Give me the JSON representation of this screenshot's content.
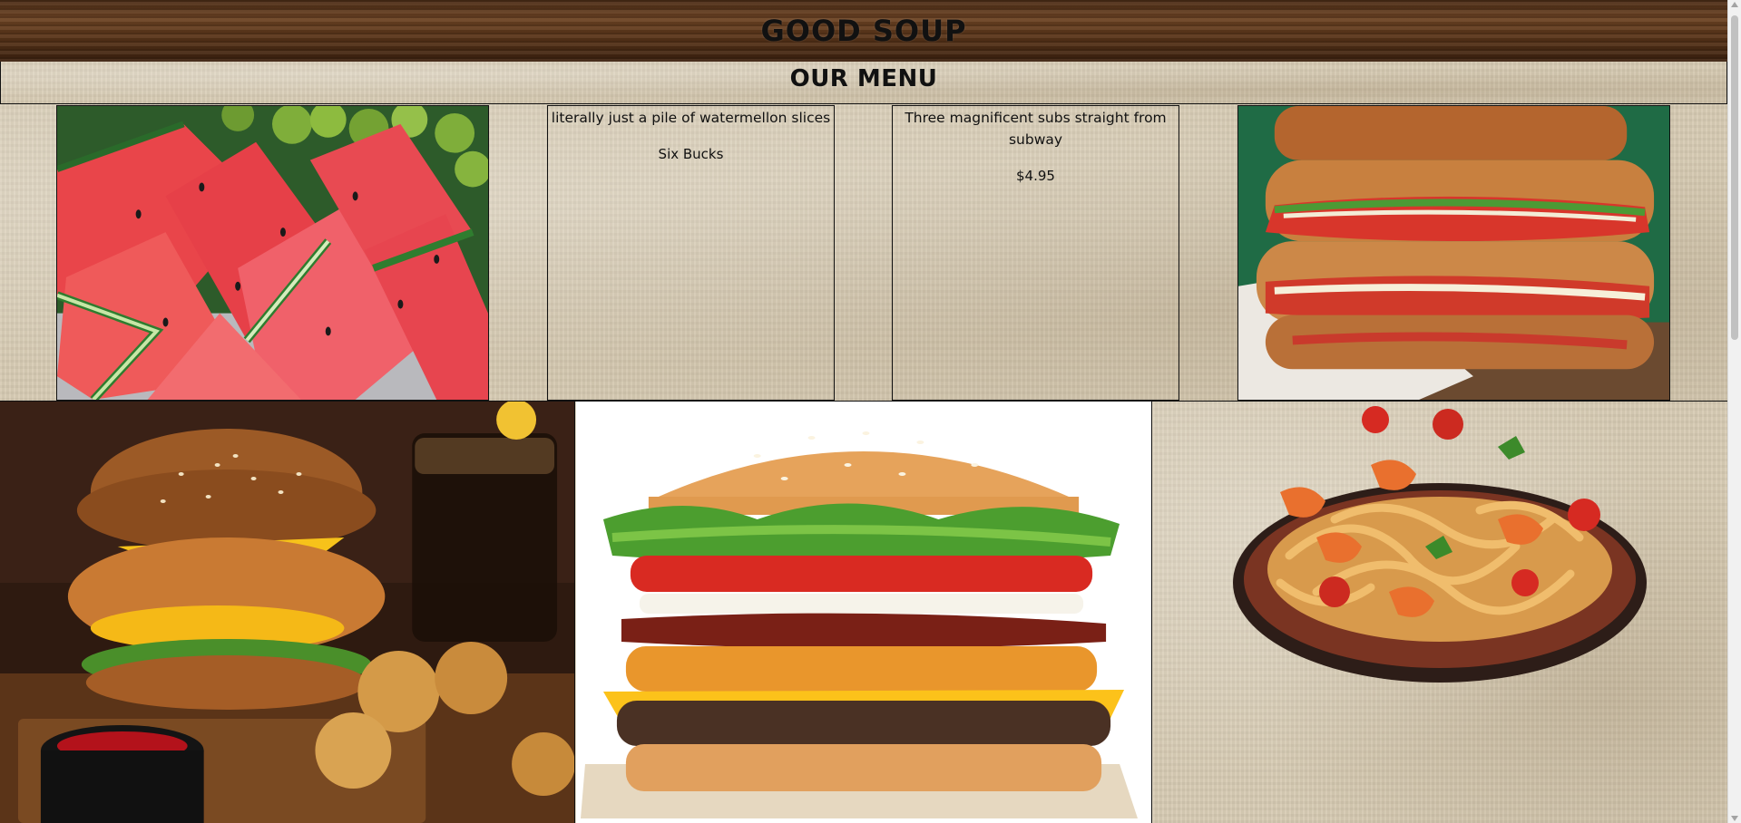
{
  "header": {
    "title": "GOOD SOUP"
  },
  "menu": {
    "heading": "OUR MENU"
  },
  "items": [
    {
      "description": "literally just a pile of watermellon slices",
      "price": "Six Bucks"
    },
    {
      "description": "Three magnificent subs straight from subway",
      "price": "$4.95"
    }
  ],
  "images": [
    {
      "icon": "watermelon-slices-image"
    },
    {
      "icon": "subs-image"
    },
    {
      "icon": "chicken-burger-image"
    },
    {
      "icon": "whopper-burger-image"
    },
    {
      "icon": "shrimp-pasta-image"
    }
  ],
  "colors": {
    "wood": "#5a3519",
    "parchment": "#d6cab2",
    "text": "#111111"
  }
}
